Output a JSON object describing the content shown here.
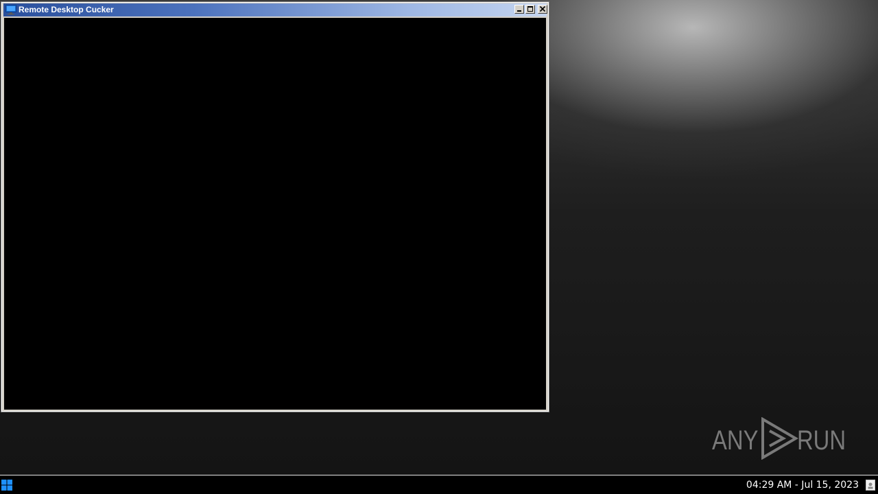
{
  "window": {
    "title": "Remote Desktop Cucker",
    "app_icon": "monitor-icon",
    "controls": [
      "minimize-icon",
      "maximize-icon",
      "close-icon"
    ]
  },
  "taskbar": {
    "start_icon": "windows-logo-icon",
    "clock": "04:29 AM - Jul 15, 2023",
    "tray_icon": "notification-icon"
  },
  "watermark": {
    "left_text": "ANY",
    "right_text": "RUN",
    "logo_icon": "play-triangle-logo-icon"
  },
  "colors": {
    "titlebar_start": "#2a4f9c",
    "titlebar_end": "#c5d5f0",
    "client_background": "#000000",
    "taskbar_background": "#000000"
  }
}
